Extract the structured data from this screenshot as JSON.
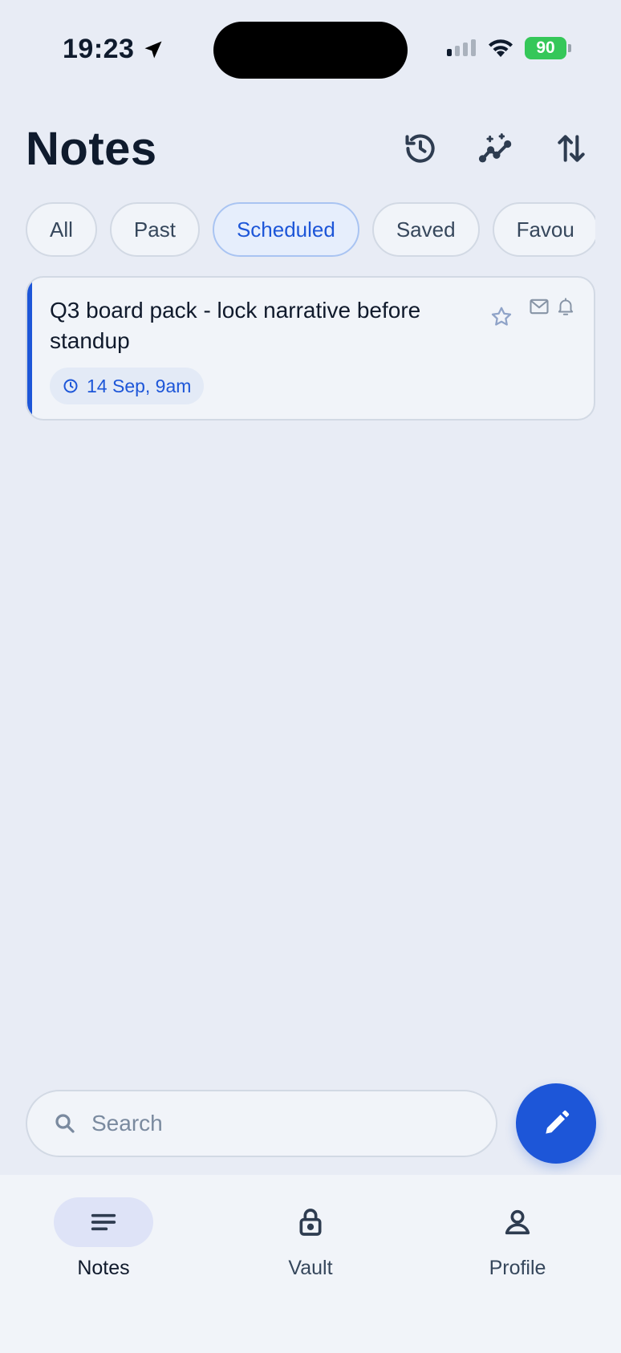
{
  "status_bar": {
    "time": "19:23",
    "battery": "90",
    "battery_color": "#35c759"
  },
  "header": {
    "title": "Notes",
    "icons": [
      "history-icon",
      "insights-icon",
      "sort-icon"
    ]
  },
  "tabs": [
    {
      "label": "All",
      "active": false
    },
    {
      "label": "Past",
      "active": false
    },
    {
      "label": "Scheduled",
      "active": true
    },
    {
      "label": "Saved",
      "active": false
    },
    {
      "label": "Favou",
      "active": false
    }
  ],
  "note": {
    "title": "Q3 board pack - lock narrative before standup",
    "schedule": "14 Sep, 9am",
    "icons": [
      "star-icon",
      "mail-icon",
      "bell-icon"
    ]
  },
  "search": {
    "placeholder": "Search",
    "value": ""
  },
  "fab": {
    "icon": "pencil-icon"
  },
  "nav": [
    {
      "label": "Notes",
      "icon": "notes-icon",
      "active": true
    },
    {
      "label": "Vault",
      "icon": "lock-icon",
      "active": false
    },
    {
      "label": "Profile",
      "icon": "person-icon",
      "active": false
    }
  ],
  "colors": {
    "accent": "#1d56d8",
    "background": "#e8ecf5",
    "surface": "#f1f4f9"
  }
}
